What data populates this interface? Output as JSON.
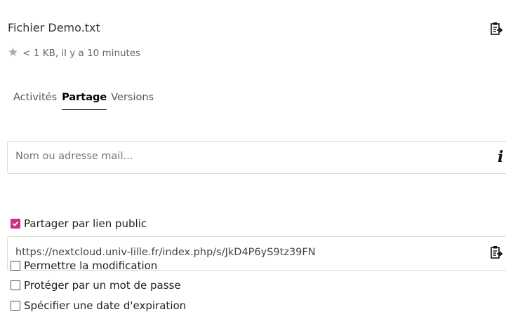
{
  "file": {
    "name": "Fichier Demo.txt",
    "meta": "< 1 KB, il y a 10 minutes",
    "star_glyph": "★"
  },
  "tabs": [
    {
      "label": "Activités",
      "active": false
    },
    {
      "label": "Partage",
      "active": true
    },
    {
      "label": "Versions",
      "active": false
    }
  ],
  "share": {
    "search_placeholder": "Nom ou adresse mail...",
    "info_glyph": "i"
  },
  "public_link": {
    "label": "Partager par lien public",
    "checked": true,
    "url": "https://nextcloud.univ-lille.fr/index.php/s/JkD4P6yS9tz39FN"
  },
  "options": [
    {
      "label": "Permettre la modification",
      "checked": false
    },
    {
      "label": "Protéger par un mot de passe",
      "checked": false
    },
    {
      "label": "Spécifier une date d'expiration",
      "checked": false
    }
  ],
  "colors": {
    "accent": "#c8327e",
    "border": "#dbdbdb"
  }
}
